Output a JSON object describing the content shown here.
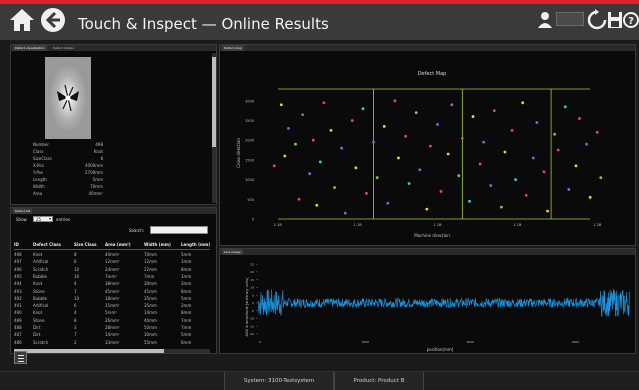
{
  "header": {
    "title": "Touch & Inspect — Online Results",
    "user_field": ""
  },
  "details_panel": {
    "tabs": [
      "Defect visualization",
      "Defect details"
    ],
    "rows": [
      {
        "label": "Number",
        "value": "498"
      },
      {
        "label": "Class",
        "value": "Knot"
      },
      {
        "label": "SizeClass",
        "value": "8"
      },
      {
        "label": "X-Pos",
        "value": "4000mm"
      },
      {
        "label": "Y-Pos",
        "value": "2700mm"
      },
      {
        "label": "Length",
        "value": "5mm"
      },
      {
        "label": "Width",
        "value": "70mm"
      },
      {
        "label": "Area",
        "value": "40mm²"
      }
    ]
  },
  "list_panel": {
    "tab": "Defect list",
    "show_label": "Show",
    "show_value": "25",
    "entries_label": "entries",
    "search_label": "Search:",
    "search_value": "",
    "columns": [
      "ID",
      "Defect Class",
      "Size Class",
      "Area (mm²)",
      "Width (mm)",
      "Length (mm)"
    ],
    "rows": [
      [
        "498",
        "Knot",
        "8",
        "40mm²",
        "70mm",
        "5mm"
      ],
      [
        "497",
        "Artifical",
        "6",
        "12mm²",
        "12mm",
        "1mm"
      ],
      [
        "496",
        "Scratch",
        "10",
        "24mm²",
        "22mm",
        "8mm"
      ],
      [
        "495",
        "Bubble",
        "10",
        "7mm²",
        "7mm",
        "1mm"
      ],
      [
        "494",
        "Knot",
        "4",
        "38mm²",
        "30mm",
        "3mm"
      ],
      [
        "493",
        "Stone",
        "7",
        "45mm²",
        "45mm",
        "8mm"
      ],
      [
        "492",
        "Bubble",
        "10",
        "18mm²",
        "35mm",
        "5mm"
      ],
      [
        "491",
        "Artifical",
        "6",
        "15mm²",
        "35mm",
        "2mm"
      ],
      [
        "490",
        "Knot",
        "4",
        "5mm²",
        "14mm",
        "8mm"
      ],
      [
        "489",
        "Stone",
        "8",
        "26mm²",
        "40mm",
        "7mm"
      ],
      [
        "488",
        "Dirt",
        "3",
        "28mm²",
        "50mm",
        "7mm"
      ],
      [
        "487",
        "Dirt",
        "7",
        "14mm²",
        "30mm",
        "5mm"
      ],
      [
        "486",
        "Scratch",
        "2",
        "33mm²",
        "55mm",
        "6mm"
      ]
    ]
  },
  "defect_map": {
    "tab": "Defect-map",
    "title": "Defect Map",
    "xlabel": "Machine direction",
    "ylabel": "Cross direction",
    "y_ticks": [
      "3000",
      "2500",
      "2000",
      "1500",
      "1000",
      "500",
      "0"
    ],
    "x_ticks": [
      "1.1B",
      "1.1B",
      "1.1B",
      "1.1B",
      "1.2B"
    ]
  },
  "signal_panel": {
    "tab": "Line image",
    "xlabel": "position[mm]",
    "ylabel": "ADU & amplitude [arbitrary units]",
    "y_ticks": [
      "25",
      "20",
      "15",
      "10",
      "5",
      "0",
      "-5",
      "-10",
      "-15",
      "-20"
    ],
    "x_ticks": [
      "0",
      "1000",
      "2000",
      "3000"
    ]
  },
  "status": {
    "system": "System: 3100-Testsystem",
    "product": "Product: Product B"
  },
  "colors": {
    "accent_red": "#e0202a",
    "signal_blue": "#1e90d8",
    "map_green": "#9ecf3a"
  },
  "chart_data": [
    {
      "type": "scatter",
      "title": "Defect Map",
      "xlabel": "Machine direction",
      "ylabel": "Cross direction",
      "ylim": [
        0,
        3300
      ],
      "y_ticks": [
        0,
        500,
        1000,
        1500,
        2000,
        2500,
        3000
      ],
      "x_tick_labels": [
        "1.1B",
        "1.1B",
        "1.1B",
        "1.1B",
        "1.2B"
      ],
      "points": [
        {
          "x": 0.04,
          "y": 1350,
          "c": "#e84b4b"
        },
        {
          "x": 0.06,
          "y": 2900,
          "c": "#f2d13c"
        },
        {
          "x": 0.08,
          "y": 2300,
          "c": "#4f7fe0"
        },
        {
          "x": 0.07,
          "y": 1600,
          "c": "#f2d13c"
        },
        {
          "x": 0.1,
          "y": 1900,
          "c": "#7ad14a"
        },
        {
          "x": 0.11,
          "y": 500,
          "c": "#e84b4b"
        },
        {
          "x": 0.12,
          "y": 2650,
          "c": "#a05ad8"
        },
        {
          "x": 0.14,
          "y": 1150,
          "c": "#4f7fe0"
        },
        {
          "x": 0.15,
          "y": 2000,
          "c": "#e84b4b"
        },
        {
          "x": 0.16,
          "y": 350,
          "c": "#f2d13c"
        },
        {
          "x": 0.17,
          "y": 1450,
          "c": "#3fc9c9"
        },
        {
          "x": 0.18,
          "y": 2950,
          "c": "#e84b4b"
        },
        {
          "x": 0.2,
          "y": 2250,
          "c": "#f2d13c"
        },
        {
          "x": 0.21,
          "y": 800,
          "c": "#7ad14a"
        },
        {
          "x": 0.23,
          "y": 1800,
          "c": "#4f7fe0"
        },
        {
          "x": 0.24,
          "y": 150,
          "c": "#a05ad8"
        },
        {
          "x": 0.26,
          "y": 2500,
          "c": "#e84b4b"
        },
        {
          "x": 0.27,
          "y": 1300,
          "c": "#f2d13c"
        },
        {
          "x": 0.29,
          "y": 2800,
          "c": "#3fc9c9"
        },
        {
          "x": 0.3,
          "y": 650,
          "c": "#e84b4b"
        },
        {
          "x": 0.32,
          "y": 1950,
          "c": "#a05ad8"
        },
        {
          "x": 0.33,
          "y": 1050,
          "c": "#7ad14a"
        },
        {
          "x": 0.35,
          "y": 2350,
          "c": "#f2d13c"
        },
        {
          "x": 0.36,
          "y": 400,
          "c": "#4f7fe0"
        },
        {
          "x": 0.38,
          "y": 3000,
          "c": "#e84b4b"
        },
        {
          "x": 0.39,
          "y": 1550,
          "c": "#f2d13c"
        },
        {
          "x": 0.41,
          "y": 2100,
          "c": "#e84b4b"
        },
        {
          "x": 0.42,
          "y": 900,
          "c": "#3fc9c9"
        },
        {
          "x": 0.44,
          "y": 2700,
          "c": "#7ad14a"
        },
        {
          "x": 0.45,
          "y": 1250,
          "c": "#a05ad8"
        },
        {
          "x": 0.47,
          "y": 250,
          "c": "#f2d13c"
        },
        {
          "x": 0.48,
          "y": 1850,
          "c": "#e84b4b"
        },
        {
          "x": 0.5,
          "y": 2400,
          "c": "#4f7fe0"
        },
        {
          "x": 0.51,
          "y": 700,
          "c": "#e84b4b"
        },
        {
          "x": 0.53,
          "y": 1650,
          "c": "#f2d13c"
        },
        {
          "x": 0.54,
          "y": 2900,
          "c": "#a05ad8"
        },
        {
          "x": 0.56,
          "y": 1100,
          "c": "#7ad14a"
        },
        {
          "x": 0.57,
          "y": 2050,
          "c": "#e84b4b"
        },
        {
          "x": 0.59,
          "y": 450,
          "c": "#3fc9c9"
        },
        {
          "x": 0.6,
          "y": 2600,
          "c": "#f2d13c"
        },
        {
          "x": 0.62,
          "y": 1400,
          "c": "#e84b4b"
        },
        {
          "x": 0.63,
          "y": 1950,
          "c": "#4f7fe0"
        },
        {
          "x": 0.65,
          "y": 850,
          "c": "#a05ad8"
        },
        {
          "x": 0.66,
          "y": 2750,
          "c": "#e84b4b"
        },
        {
          "x": 0.68,
          "y": 300,
          "c": "#7ad14a"
        },
        {
          "x": 0.69,
          "y": 1700,
          "c": "#f2d13c"
        },
        {
          "x": 0.71,
          "y": 2250,
          "c": "#e84b4b"
        },
        {
          "x": 0.72,
          "y": 1000,
          "c": "#3fc9c9"
        },
        {
          "x": 0.74,
          "y": 2950,
          "c": "#f2d13c"
        },
        {
          "x": 0.75,
          "y": 600,
          "c": "#e84b4b"
        },
        {
          "x": 0.77,
          "y": 1550,
          "c": "#a05ad8"
        },
        {
          "x": 0.78,
          "y": 2450,
          "c": "#4f7fe0"
        },
        {
          "x": 0.8,
          "y": 1200,
          "c": "#e84b4b"
        },
        {
          "x": 0.81,
          "y": 200,
          "c": "#f2d13c"
        },
        {
          "x": 0.83,
          "y": 2150,
          "c": "#7ad14a"
        },
        {
          "x": 0.84,
          "y": 1750,
          "c": "#e84b4b"
        },
        {
          "x": 0.86,
          "y": 2850,
          "c": "#3fc9c9"
        },
        {
          "x": 0.87,
          "y": 750,
          "c": "#a05ad8"
        },
        {
          "x": 0.89,
          "y": 1350,
          "c": "#f2d13c"
        },
        {
          "x": 0.9,
          "y": 2550,
          "c": "#e84b4b"
        },
        {
          "x": 0.92,
          "y": 1900,
          "c": "#4f7fe0"
        },
        {
          "x": 0.93,
          "y": 550,
          "c": "#f2d13c"
        },
        {
          "x": 0.95,
          "y": 2200,
          "c": "#e84b4b"
        },
        {
          "x": 0.96,
          "y": 1050,
          "c": "#7ad14a"
        }
      ]
    },
    {
      "type": "line",
      "xlabel": "position[mm]",
      "ylabel": "ADU & amplitude [arbitrary units]",
      "ylim": [
        -22,
        27
      ],
      "y_ticks": [
        25,
        20,
        15,
        10,
        5,
        0,
        -5,
        -10,
        -15,
        -20
      ],
      "x_ticks": [
        0,
        1000,
        2000,
        3000
      ],
      "series": [
        {
          "baseline": 0,
          "edge_amplitude": 9,
          "core_amplitude": 3
        }
      ]
    }
  ]
}
